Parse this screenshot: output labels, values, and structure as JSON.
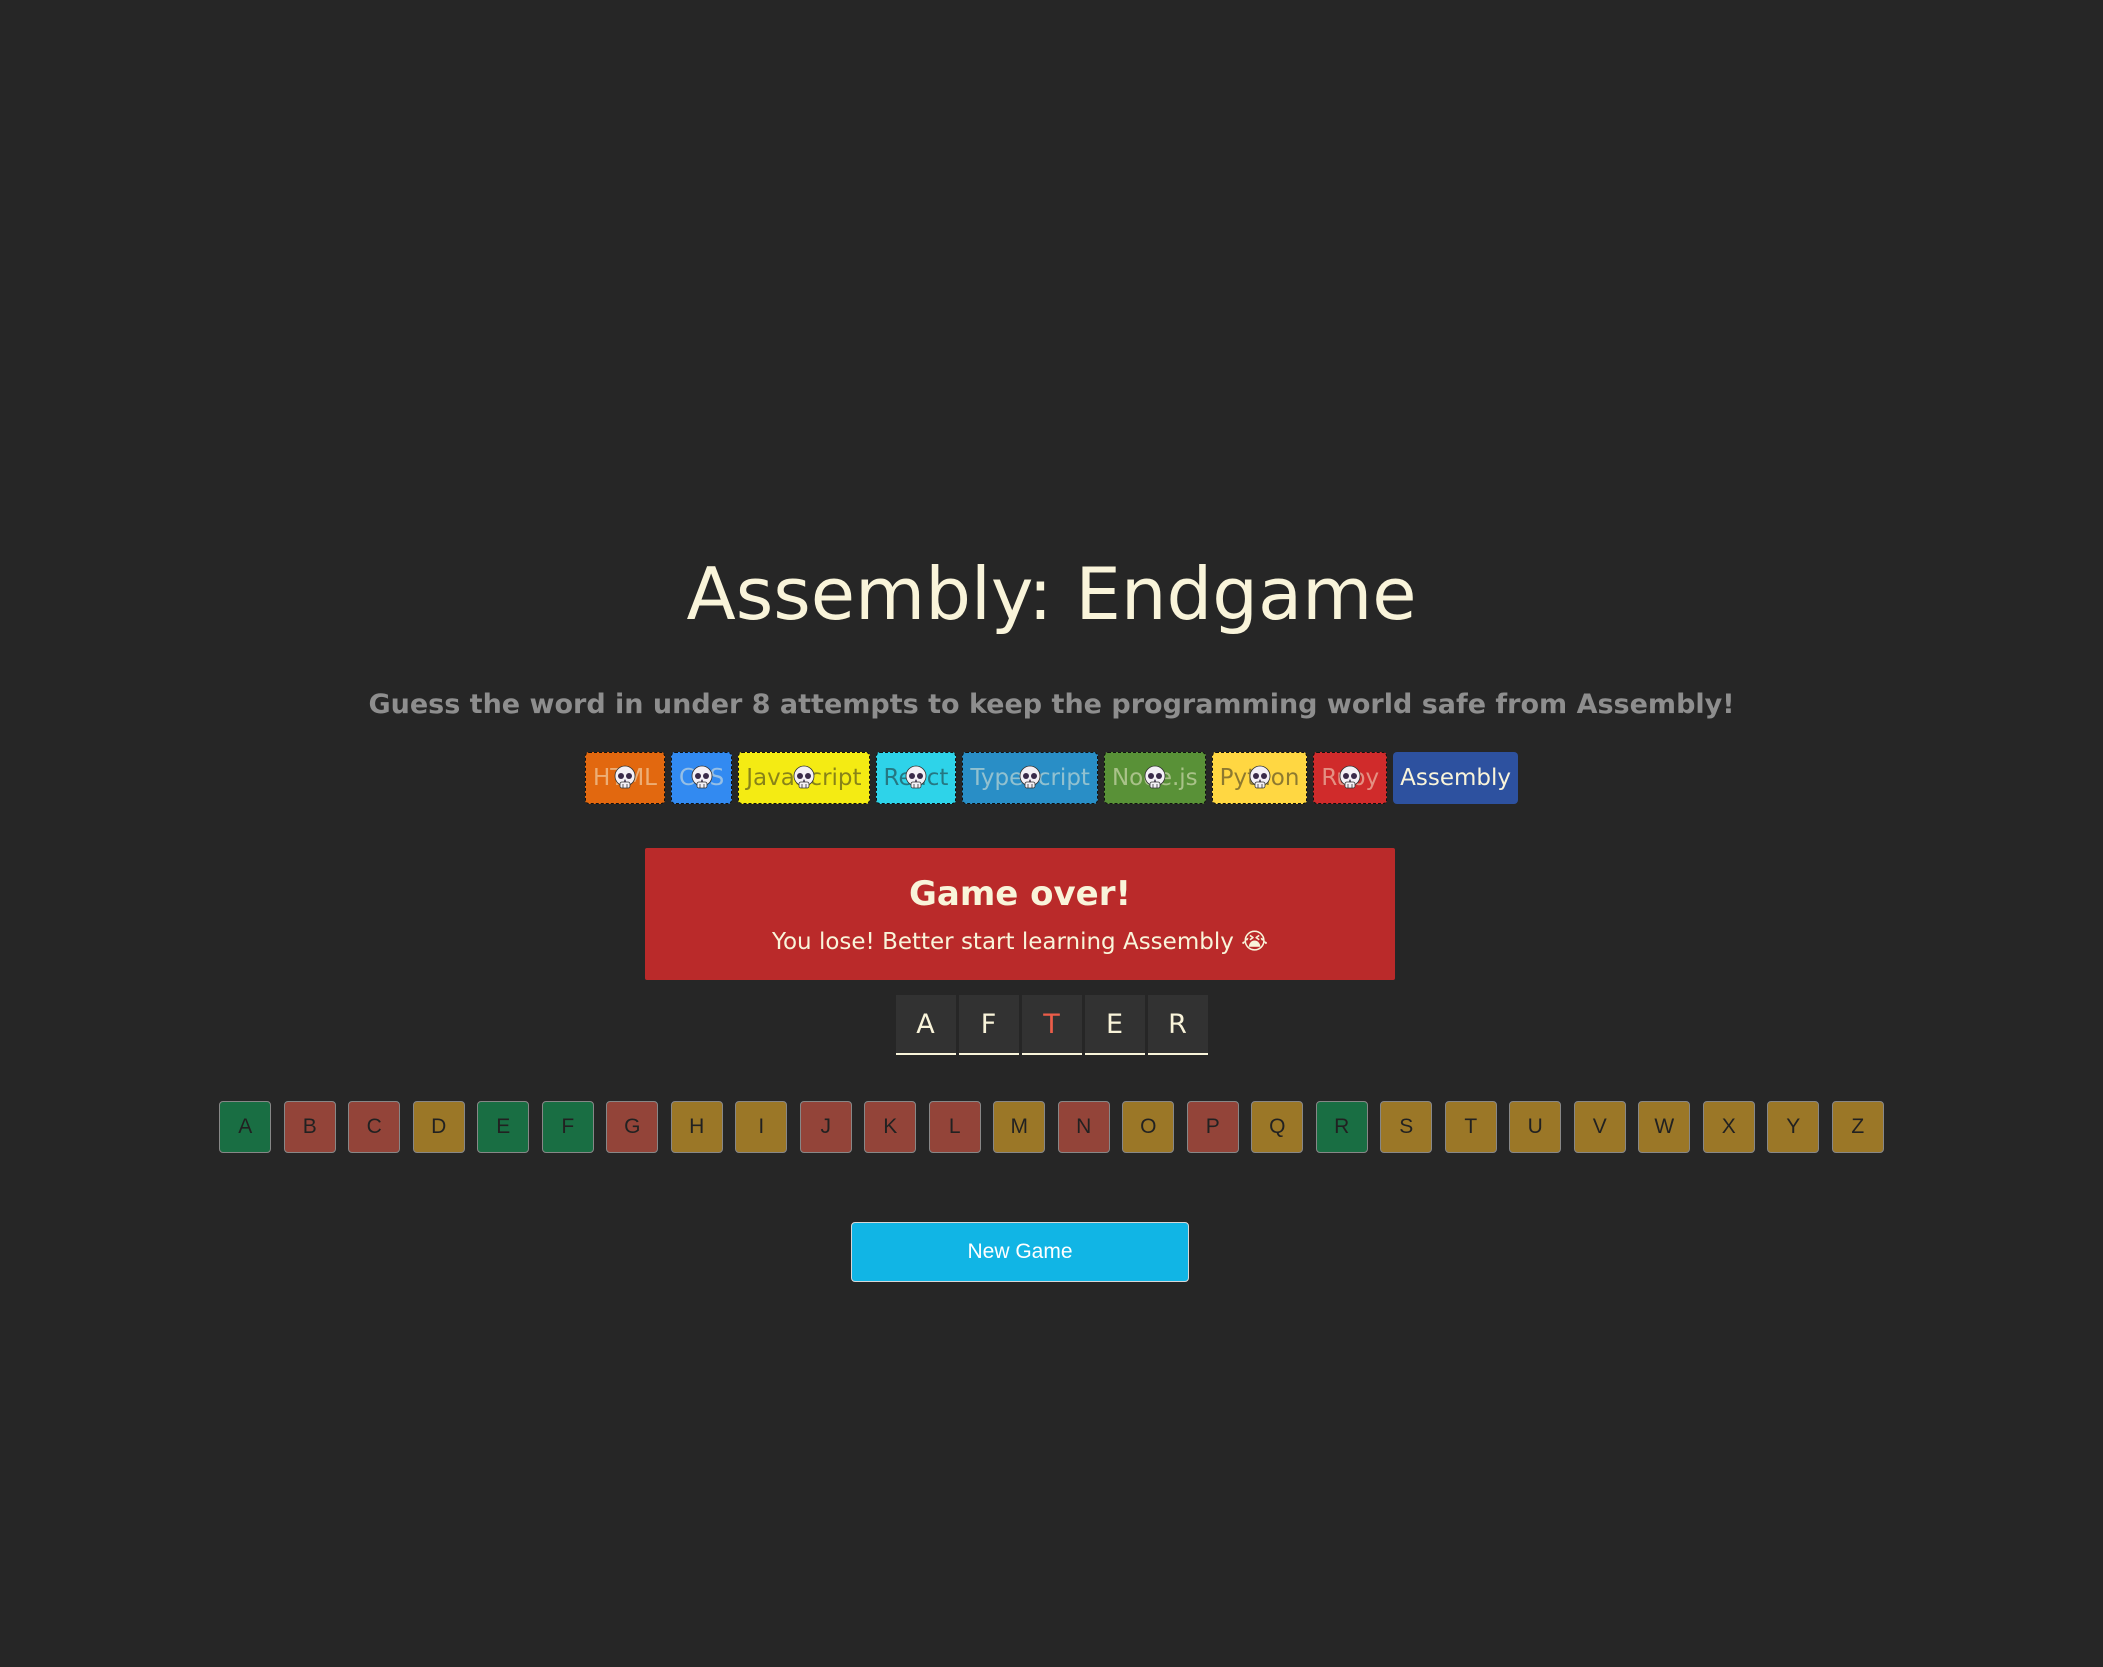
{
  "header": {
    "title": "Assembly: Endgame",
    "subtitle": "Guess the word in under 8 attempts to keep the programming world safe from Assembly!"
  },
  "languages": [
    {
      "name": "HTML",
      "bg": "#E2680F",
      "color": "#F9F4DA",
      "lost": true
    },
    {
      "name": "CSS",
      "bg": "#328AF1",
      "color": "#F9F4DA",
      "lost": true
    },
    {
      "name": "JavaScript",
      "bg": "#F4EB13",
      "color": "#1E1E1E",
      "lost": true
    },
    {
      "name": "React",
      "bg": "#2ED3E9",
      "color": "#1E1E1E",
      "lost": true
    },
    {
      "name": "TypeScript",
      "bg": "#298EC6",
      "color": "#F9F4DA",
      "lost": true
    },
    {
      "name": "Node.js",
      "bg": "#599137",
      "color": "#F9F4DA",
      "lost": true
    },
    {
      "name": "Python",
      "bg": "#FFD742",
      "color": "#1E1E1E",
      "lost": true
    },
    {
      "name": "Ruby",
      "bg": "#D02B2B",
      "color": "#F9F4DA",
      "lost": true
    },
    {
      "name": "Assembly",
      "bg": "#2D519F",
      "color": "#F9F4DA",
      "lost": false
    }
  ],
  "status": {
    "title": "Game over!",
    "message": "You lose! Better start learning Assembly 😭",
    "bg": "#BA2A2A"
  },
  "word": [
    {
      "letter": "A",
      "missed": false
    },
    {
      "letter": "F",
      "missed": false
    },
    {
      "letter": "T",
      "missed": true
    },
    {
      "letter": "E",
      "missed": false
    },
    {
      "letter": "R",
      "missed": false
    }
  ],
  "keyboard": [
    {
      "letter": "A",
      "state": "correct"
    },
    {
      "letter": "B",
      "state": "wrong"
    },
    {
      "letter": "C",
      "state": "wrong"
    },
    {
      "letter": "D",
      "state": "unused"
    },
    {
      "letter": "E",
      "state": "correct"
    },
    {
      "letter": "F",
      "state": "correct"
    },
    {
      "letter": "G",
      "state": "wrong"
    },
    {
      "letter": "H",
      "state": "unused"
    },
    {
      "letter": "I",
      "state": "unused"
    },
    {
      "letter": "J",
      "state": "wrong"
    },
    {
      "letter": "K",
      "state": "wrong"
    },
    {
      "letter": "L",
      "state": "wrong"
    },
    {
      "letter": "M",
      "state": "unused"
    },
    {
      "letter": "N",
      "state": "wrong"
    },
    {
      "letter": "O",
      "state": "unused"
    },
    {
      "letter": "P",
      "state": "wrong"
    },
    {
      "letter": "Q",
      "state": "unused"
    },
    {
      "letter": "R",
      "state": "correct"
    },
    {
      "letter": "S",
      "state": "unused"
    },
    {
      "letter": "T",
      "state": "unused"
    },
    {
      "letter": "U",
      "state": "unused"
    },
    {
      "letter": "V",
      "state": "unused"
    },
    {
      "letter": "W",
      "state": "unused"
    },
    {
      "letter": "X",
      "state": "unused"
    },
    {
      "letter": "Y",
      "state": "unused"
    },
    {
      "letter": "Z",
      "state": "unused"
    }
  ],
  "key_colors": {
    "correct": "#10A95B",
    "wrong": "#EC5D49",
    "unused": "#FCBA29"
  },
  "icons": {
    "lost_marker": "skull-icon"
  },
  "actions": {
    "new_game_label": "New Game",
    "new_game_bg": "#11B5E5"
  }
}
